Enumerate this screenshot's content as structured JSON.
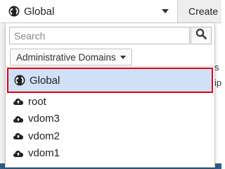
{
  "header": {
    "selected_scope": "Global",
    "icon": "globe-icon"
  },
  "background": {
    "create_tab_label": "Create",
    "frag_1": "s",
    "frag_2": "ip",
    "bar_color": "#2f5d86"
  },
  "dropdown": {
    "search": {
      "placeholder": "Search",
      "value": ""
    },
    "filter_label": "Administrative Domains",
    "items": [
      {
        "label": "Global",
        "icon": "globe-icon",
        "selected": true
      },
      {
        "label": "root",
        "icon": "cloud-icon",
        "selected": false
      },
      {
        "label": "vdom3",
        "icon": "cloud-icon",
        "selected": false
      },
      {
        "label": "vdom2",
        "icon": "cloud-icon",
        "selected": false
      },
      {
        "label": "vdom1",
        "icon": "cloud-icon",
        "selected": false
      }
    ]
  },
  "colors": {
    "selected_bg": "#cfe0f7",
    "highlight_border": "#d9001b"
  }
}
